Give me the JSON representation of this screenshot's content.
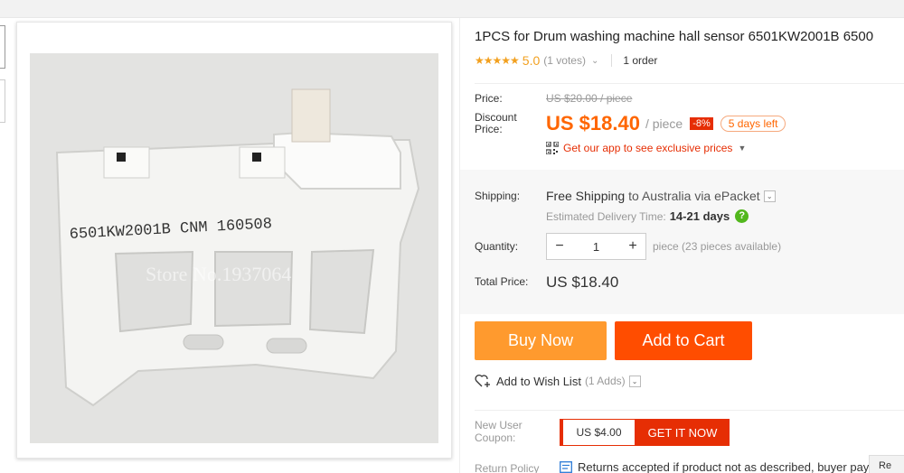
{
  "product": {
    "title": "1PCS for Drum washing machine hall sensor 6501KW2001B 6500",
    "stars": "★★★★★",
    "rating": "5.0",
    "votes": "(1 votes)",
    "orders": "1 order"
  },
  "price": {
    "label": "Price:",
    "original": "US $20.00 / piece",
    "discount_label": "Discount\nPrice:",
    "current": "US $18.40",
    "per_piece": "/ piece",
    "discount_badge": "-8%",
    "days_left": "5 days left",
    "app_promo": "Get our app to see exclusive prices"
  },
  "shipping": {
    "label": "Shipping:",
    "free": "Free Shipping",
    "destination": "to  Australia via ePacket",
    "delivery_label": "Estimated Delivery Time:",
    "delivery_days": "14-21 days"
  },
  "quantity": {
    "label": "Quantity:",
    "value": "1",
    "minus": "−",
    "plus": "+",
    "available": "piece (23 pieces available)"
  },
  "total": {
    "label": "Total Price:",
    "value": "US $18.40"
  },
  "actions": {
    "buy_now": "Buy Now",
    "add_to_cart": "Add to Cart",
    "wish_list": "Add to Wish List",
    "wish_count": "(1 Adds)"
  },
  "coupon": {
    "label": "New User\nCoupon:",
    "amount": "US $4.00",
    "cta": "GET IT NOW"
  },
  "returns": {
    "label": "Return Policy",
    "text": "Returns accepted if product not as described, buyer pays",
    "side_tab": "Re"
  },
  "image": {
    "part_label": "6501KW2001B CNM 160508",
    "watermark": "Store No.1937064"
  },
  "colors": {
    "accent": "#ff6600",
    "buy_now": "#ff9a2e",
    "add_to_cart": "#ff4d00",
    "badge_red": "#e62e04",
    "help_green": "#52b71d",
    "star": "#f2a01f"
  },
  "icons": [
    "qr-code-icon",
    "chevron-down-icon",
    "help-icon",
    "heart-plus-icon",
    "return-policy-icon"
  ]
}
